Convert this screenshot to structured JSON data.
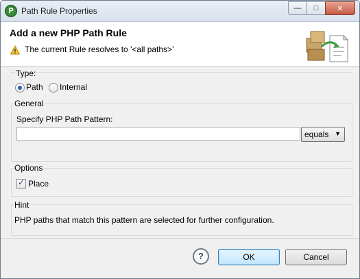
{
  "window": {
    "title": "Path Rule Properties",
    "app_icon_letter": "P",
    "controls": {
      "minimize": "—",
      "maximize": "□",
      "close": "✕"
    }
  },
  "header": {
    "title": "Add a new PHP Path Rule",
    "message": "The current Rule resolves to '<all paths>'"
  },
  "type_group": {
    "label": "Type:",
    "options": [
      {
        "label": "Path",
        "checked": true
      },
      {
        "label": "Internal",
        "checked": false
      }
    ]
  },
  "general_group": {
    "label": "General",
    "pattern_label": "Specify PHP Path Pattern:",
    "pattern_value": "",
    "match_select": {
      "selected": "equals"
    }
  },
  "options_group": {
    "label": "Options",
    "place_label": "Place",
    "place_checked": true
  },
  "hint_group": {
    "label": "Hint",
    "text": "PHP paths that match this pattern are selected for further configuration."
  },
  "footer": {
    "help_symbol": "?",
    "ok_label": "OK",
    "cancel_label": "Cancel"
  }
}
